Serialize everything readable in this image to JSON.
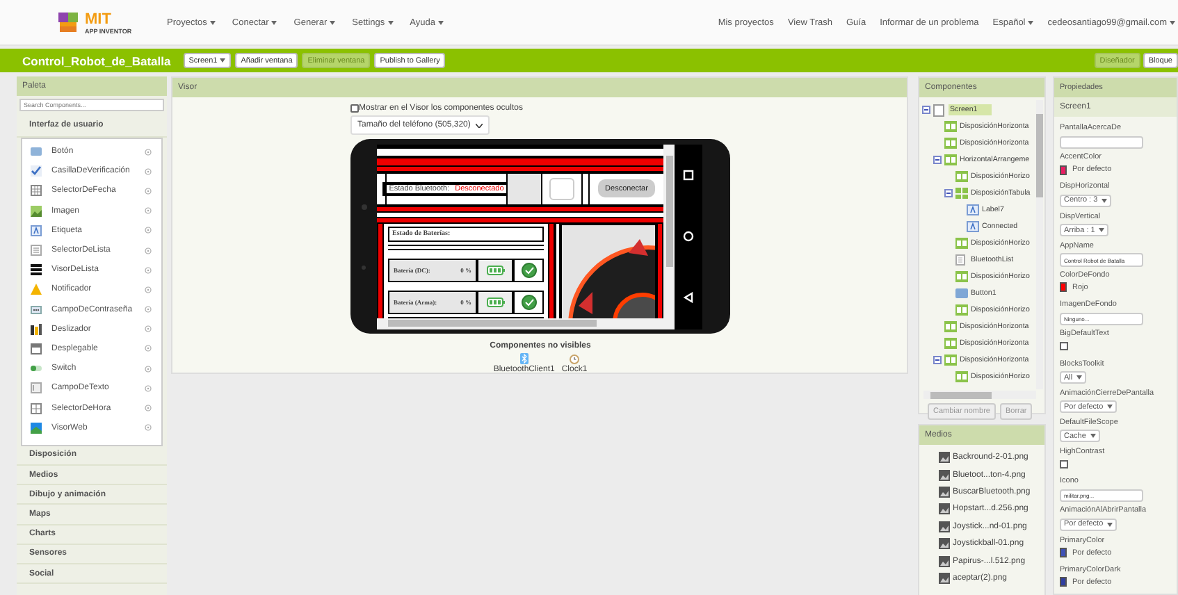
{
  "topbar": {
    "logo_title": "MIT",
    "logo_subtitle": "APP INVENTOR",
    "menus": [
      "Proyectos",
      "Conectar",
      "Generar",
      "Settings",
      "Ayuda"
    ],
    "links": [
      "Mis proyectos",
      "View Trash",
      "Guía",
      "Informar de un problema"
    ],
    "language": "Español",
    "account": "cedeosantiago99@gmail.com"
  },
  "project_bar": {
    "name": "Control_Robot_de_Batalla",
    "buttons": [
      {
        "label": "Screen1",
        "kind": "dropdown",
        "disabled": false
      },
      {
        "label": "Añadir ventana",
        "kind": "plain",
        "disabled": false
      },
      {
        "label": "Eliminar ventana",
        "kind": "plain",
        "disabled": true
      },
      {
        "label": "Publish to Gallery",
        "kind": "plain",
        "disabled": false
      }
    ],
    "view_buttons": [
      {
        "label": "Diseñador",
        "selected": true
      },
      {
        "label": "Bloque",
        "selected": false
      }
    ]
  },
  "palette": {
    "title": "Paleta",
    "search_placeholder": "Search Components...",
    "categories": [
      {
        "label": "Interfaz de usuario",
        "expanded": true,
        "items": [
          {
            "label": "Botón",
            "kind": "button"
          },
          {
            "label": "CasillaDeVerificación",
            "kind": "checkbox"
          },
          {
            "label": "SelectorDeFecha",
            "kind": "datepicker"
          },
          {
            "label": "Imagen",
            "kind": "image"
          },
          {
            "label": "Etiqueta",
            "kind": "label"
          },
          {
            "label": "SelectorDeLista",
            "kind": "listpicker"
          },
          {
            "label": "VisorDeLista",
            "kind": "listview"
          },
          {
            "label": "Notificador",
            "kind": "notifier"
          },
          {
            "label": "CampoDeContraseña",
            "kind": "password"
          },
          {
            "label": "Deslizador",
            "kind": "slider"
          },
          {
            "label": "Desplegable",
            "kind": "spinner"
          },
          {
            "label": "Switch",
            "kind": "switch"
          },
          {
            "label": "CampoDeTexto",
            "kind": "textbox"
          },
          {
            "label": "SelectorDeHora",
            "kind": "timepicker"
          },
          {
            "label": "VisorWeb",
            "kind": "webviewer"
          }
        ]
      },
      {
        "label": "Disposición",
        "expanded": false
      },
      {
        "label": "Medios",
        "expanded": false
      },
      {
        "label": "Dibujo y animación",
        "expanded": false
      },
      {
        "label": "Maps",
        "expanded": false
      },
      {
        "label": "Charts",
        "expanded": false
      },
      {
        "label": "Sensores",
        "expanded": false
      },
      {
        "label": "Social",
        "expanded": false
      }
    ]
  },
  "viewer": {
    "title": "Visor",
    "show_hidden": {
      "label": "Mostrar en el Visor los componentes ocultos",
      "checked": false
    },
    "size_select": "Tamaño del teléfono (505,320)",
    "phone": {
      "bt_label": "Estado Bluetooth:",
      "bt_status": "Desconectado",
      "disconnect_button": "Desconectar",
      "battery_title": "Estado de Baterías:",
      "batteries": [
        {
          "label": "Batería (DC):",
          "reading": "0 %"
        },
        {
          "label": "Batería (Arma):",
          "reading": "0 %"
        }
      ]
    },
    "nonvisible_title": "Componentes no visibles",
    "nonvisible": [
      {
        "label": "BluetoothClient1",
        "kind": "bluetooth"
      },
      {
        "label": "Clock1",
        "kind": "clock"
      }
    ]
  },
  "components": {
    "title": "Componentes",
    "tree": [
      {
        "label": "Screen1",
        "kind": "screen",
        "selected": true,
        "expanded": true,
        "children": [
          {
            "label": "DisposiciónHorizonta",
            "kind": "arrangement",
            "selected": false
          },
          {
            "label": "DisposiciónHorizonta",
            "kind": "arrangement",
            "selected": false
          },
          {
            "label": "HorizontalArrangeme",
            "kind": "arrangement",
            "selected": false,
            "expanded": true,
            "children": [
              {
                "label": "DisposiciónHorizo",
                "kind": "arrangement",
                "selected": false
              },
              {
                "label": "DisposiciónTabula",
                "kind": "table",
                "selected": false,
                "expanded": true,
                "children": [
                  {
                    "label": "Label7",
                    "kind": "label",
                    "selected": false
                  },
                  {
                    "label": "Connected",
                    "kind": "label",
                    "selected": false
                  }
                ]
              },
              {
                "label": "DisposiciónHorizo",
                "kind": "arrangement",
                "selected": false
              },
              {
                "label": "BluetoothList",
                "kind": "listpicker",
                "selected": false
              },
              {
                "label": "DisposiciónHorizo",
                "kind": "arrangement",
                "selected": false
              },
              {
                "label": "Button1",
                "kind": "button",
                "selected": false
              },
              {
                "label": "DisposiciónHorizo",
                "kind": "arrangement",
                "selected": false
              }
            ]
          },
          {
            "label": "DisposiciónHorizonta",
            "kind": "arrangement",
            "selected": false
          },
          {
            "label": "DisposiciónHorizonta",
            "kind": "arrangement",
            "selected": false
          },
          {
            "label": "DisposiciónHorizonta",
            "kind": "arrangement",
            "selected": false,
            "expanded": true,
            "children": [
              {
                "label": "DisposiciónHorizo",
                "kind": "arrangement",
                "selected": false
              }
            ]
          }
        ]
      }
    ],
    "buttons": [
      {
        "label": "Cambiar nombre",
        "disabled": true
      },
      {
        "label": "Borrar",
        "disabled": true
      }
    ]
  },
  "media": {
    "title": "Medios",
    "files": [
      "Backround-2-01.png",
      "Bluetoot...ton-4.png",
      "BuscarBluetooth.png",
      "Hopstart...d.256.png",
      "Joystick...nd-01.png",
      "Joystickball-01.png",
      "Papirus-...l.512.png",
      "aceptar(2).png"
    ]
  },
  "properties": {
    "title": "Propiedades",
    "component": "Screen1",
    "items": [
      {
        "label": "PantallaAcercaDe",
        "kind": "textarea"
      },
      {
        "label": "AccentColor",
        "kind": "color",
        "color": "#e91e63",
        "value": "Por defecto"
      },
      {
        "label": "DispHorizontal",
        "kind": "select",
        "value": "Centro : 3"
      },
      {
        "label": "DispVertical",
        "kind": "select",
        "value": "Arriba : 1"
      },
      {
        "label": "AppName",
        "kind": "text",
        "value": "Control Robot de Batalla"
      },
      {
        "label": "ColorDeFondo",
        "kind": "color",
        "color": "#ff0000",
        "value": "Rojo"
      },
      {
        "label": "ImagenDeFondo",
        "kind": "text",
        "value": "Ninguno..."
      },
      {
        "label": "BigDefaultText",
        "kind": "checkbox",
        "checked": false
      },
      {
        "label": "BlocksToolkit",
        "kind": "select",
        "value": "All"
      },
      {
        "label": "AnimaciónCierreDePantalla",
        "kind": "select",
        "value": "Por defecto"
      },
      {
        "label": "DefaultFileScope",
        "kind": "select",
        "value": "Cache"
      },
      {
        "label": "HighContrast",
        "kind": "checkbox",
        "checked": false
      },
      {
        "label": "Icono",
        "kind": "text",
        "value": "militar.png..."
      },
      {
        "label": "AnimaciónAlAbrirPantalla",
        "kind": "select",
        "value": "Por defecto"
      },
      {
        "label": "PrimaryColor",
        "kind": "color",
        "color": "#3f51b5",
        "value": "Por defecto"
      },
      {
        "label": "PrimaryColorDark",
        "kind": "color",
        "color": "#303f9f",
        "value": "Por defecto"
      }
    ]
  }
}
